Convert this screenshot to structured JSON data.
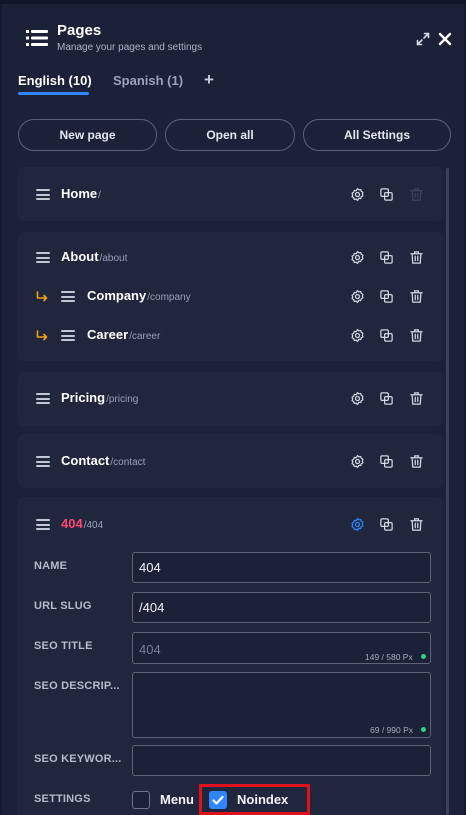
{
  "header": {
    "title": "Pages",
    "subtitle": "Manage your pages and settings",
    "menu_icon": "list-icon",
    "expand_icon": "expand-icon",
    "close_icon": "close-icon"
  },
  "tabs": [
    {
      "label": "English (10)",
      "active": true
    },
    {
      "label": "Spanish (1)",
      "active": false
    }
  ],
  "add_tab_symbol": "+",
  "actions": {
    "new_page": "New page",
    "open_all": "Open all",
    "all_settings": "All Settings"
  },
  "pages": [
    {
      "name": "Home",
      "slug": "/",
      "delete_disabled": true
    },
    {
      "name": "About",
      "slug": "/about"
    },
    {
      "name": "Company",
      "slug": "/company",
      "child": true
    },
    {
      "name": "Career",
      "slug": "/career",
      "child": true
    },
    {
      "name": "Pricing",
      "slug": "/pricing"
    },
    {
      "name": "Contact",
      "slug": "/contact"
    },
    {
      "name": "404",
      "slug": "/404",
      "expanded": true,
      "name_color": "#ff4770"
    }
  ],
  "form": {
    "name_label": "NAME",
    "name_value": "404",
    "slug_label": "URL SLUG",
    "slug_value": "/404",
    "seo_title_label": "SEO TITLE",
    "seo_title_placeholder": "404",
    "seo_title_count": "149 / 580 Px",
    "seo_desc_label": "SEO DESCRIP...",
    "seo_desc_value": "",
    "seo_desc_count": "69 / 990 Px",
    "seo_keywords_label": "SEO KEYWOR...",
    "seo_keywords_value": "",
    "settings_label": "SETTINGS",
    "menu_label": "Menu",
    "menu_checked": false,
    "noindex_label": "Noindex",
    "noindex_checked": true
  },
  "colors": {
    "accent": "#2f86ff",
    "child_arrow": "#f0a020",
    "error": "#ff4770",
    "ok_dot": "#2fd08a",
    "highlight": "#e0101c"
  }
}
